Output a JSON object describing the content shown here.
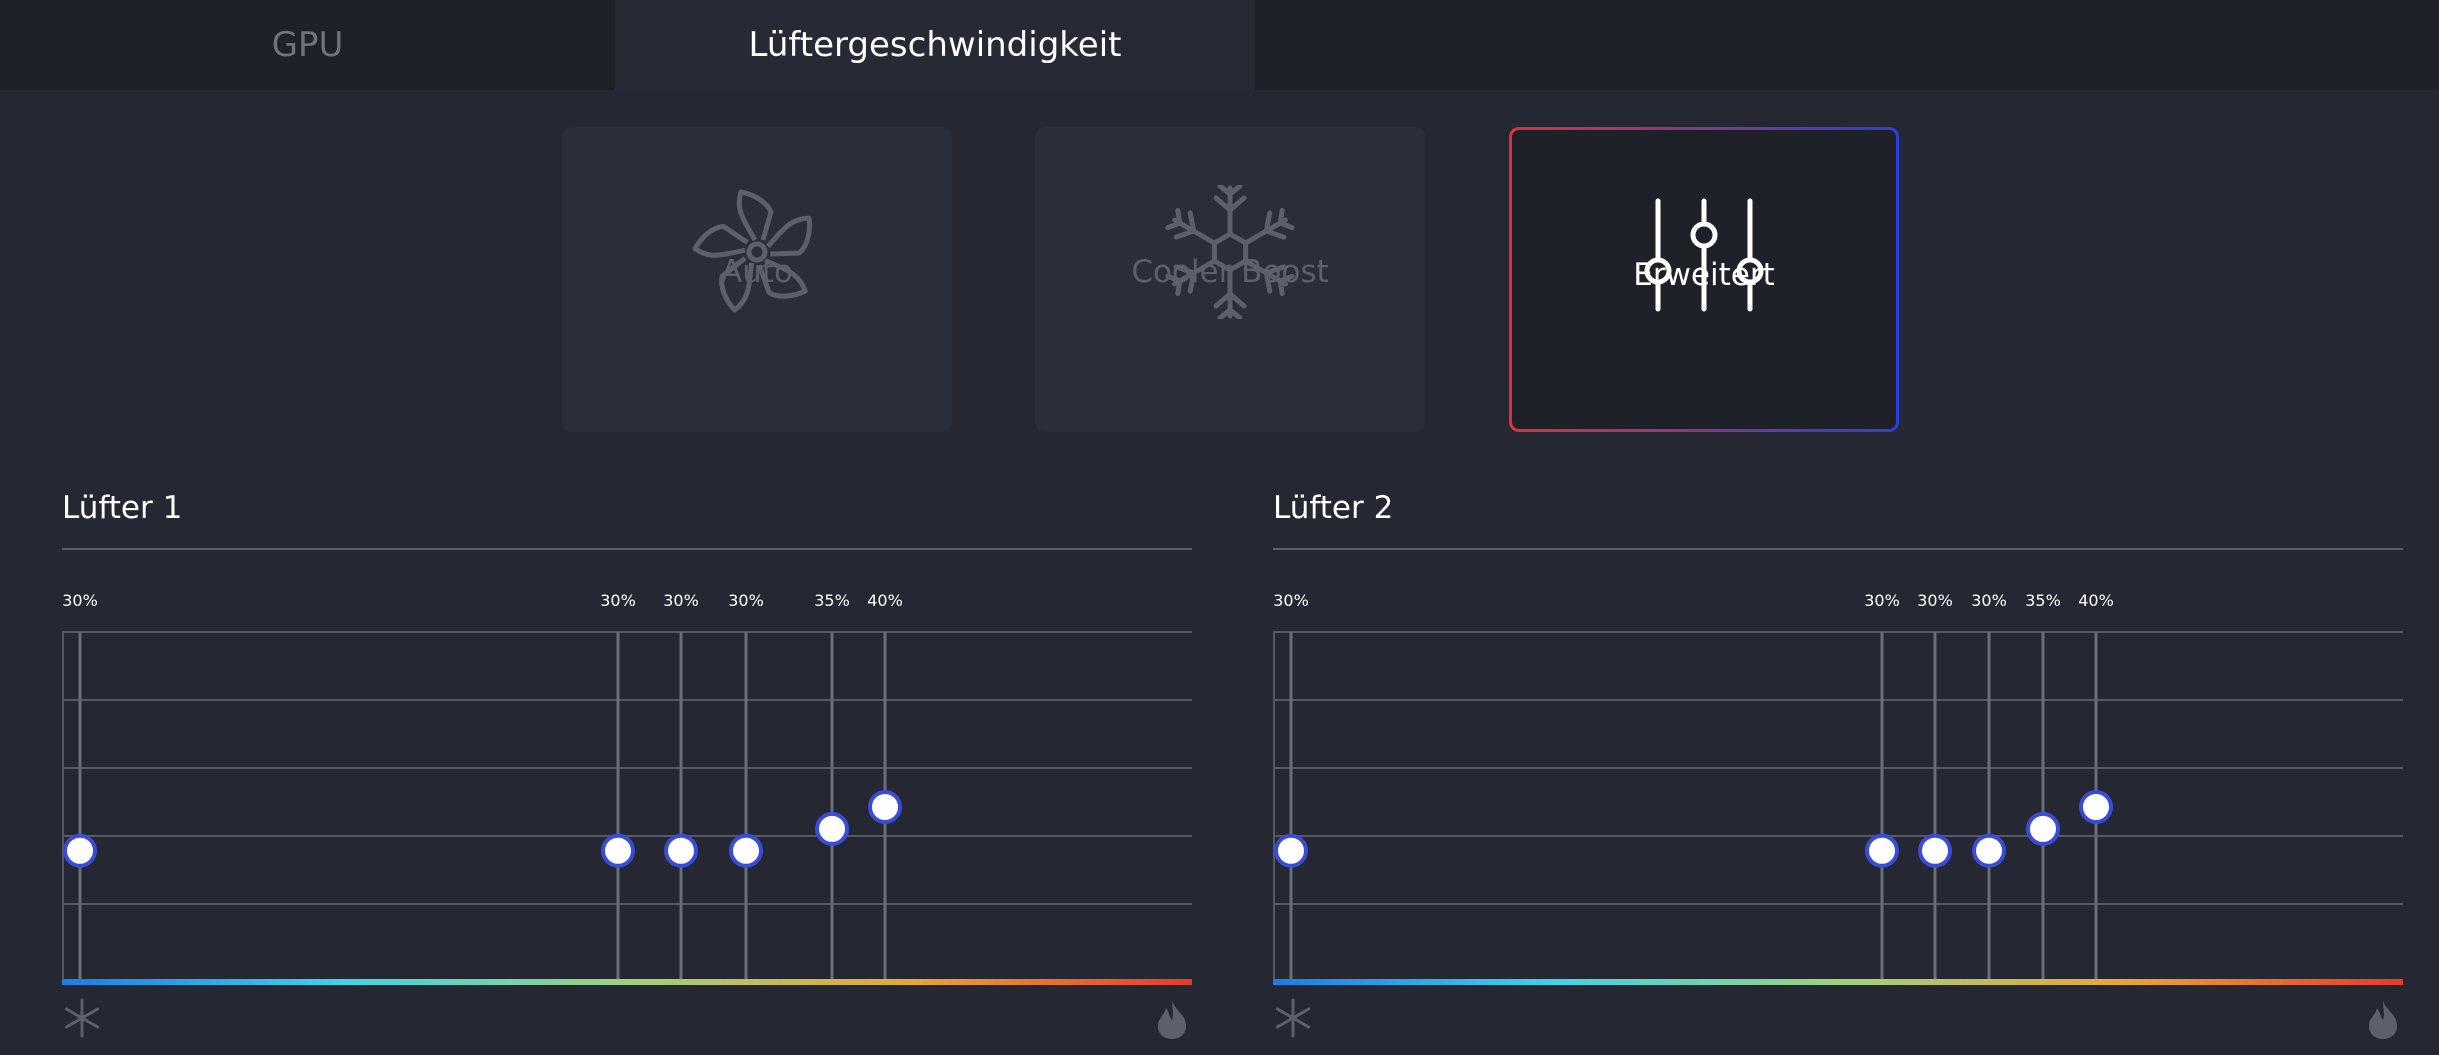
{
  "tabs": [
    {
      "label": "GPU",
      "active": false
    },
    {
      "label": "Lüftergeschwindigkeit",
      "active": true
    }
  ],
  "modes": [
    {
      "label": "Auto",
      "icon": "fan-icon",
      "selected": false
    },
    {
      "label": "Cooler Boost",
      "icon": "snowflake-icon",
      "selected": false
    },
    {
      "label": "Erweitert",
      "icon": "sliders-icon",
      "selected": true
    }
  ],
  "fans": [
    {
      "title": "Lüfter 1",
      "points": [
        {
          "label": "30%",
          "value": 30
        },
        {
          "label": "30%",
          "value": 30
        },
        {
          "label": "30%",
          "value": 30
        },
        {
          "label": "30%",
          "value": 30
        },
        {
          "label": "35%",
          "value": 35
        },
        {
          "label": "40%",
          "value": 40
        }
      ]
    },
    {
      "title": "Lüfter 2",
      "points": [
        {
          "label": "30%",
          "value": 30
        },
        {
          "label": "30%",
          "value": 30
        },
        {
          "label": "30%",
          "value": 30
        },
        {
          "label": "30%",
          "value": 30
        },
        {
          "label": "35%",
          "value": 35
        },
        {
          "label": "40%",
          "value": 40
        }
      ]
    }
  ],
  "colors": {
    "accent": "#3a4bd8",
    "selected_border_start": "#e0303c",
    "selected_border_end": "#2a3fe0",
    "gradient": [
      "#1f7be6",
      "#43d4e6",
      "#9ed080",
      "#e6a83a",
      "#e63a2a"
    ]
  }
}
